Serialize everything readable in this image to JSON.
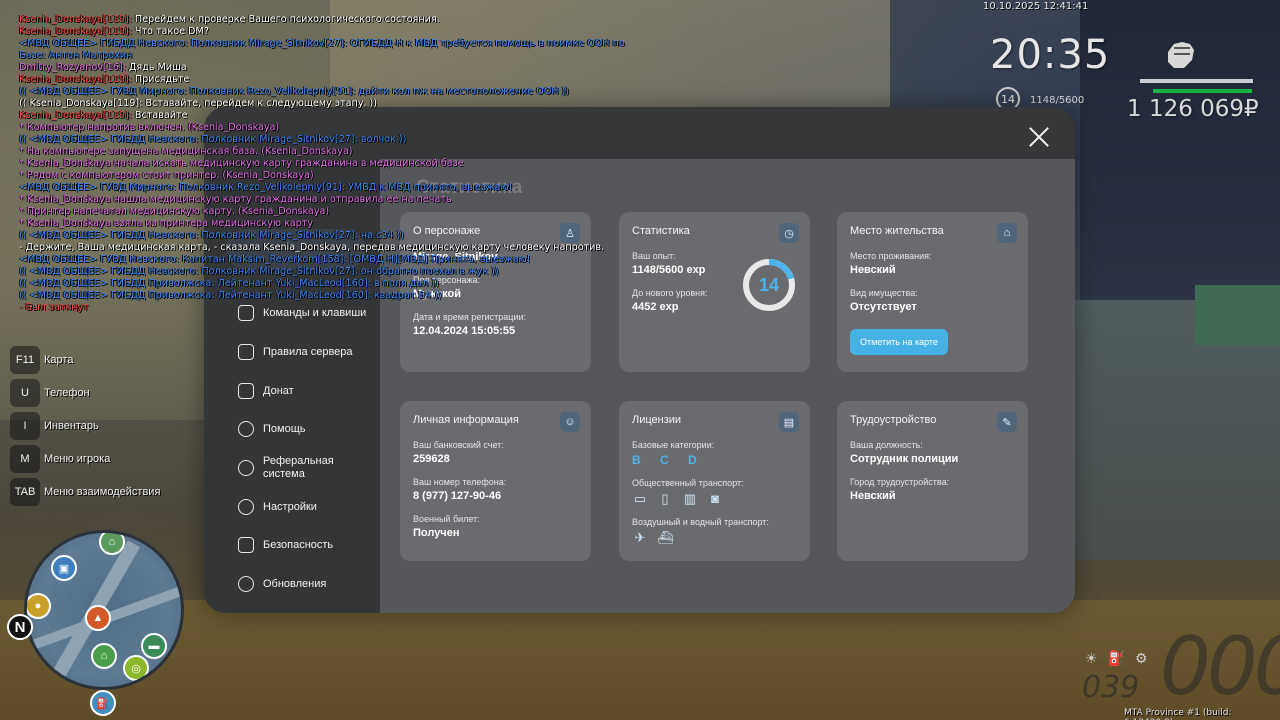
{
  "chat": [
    {
      "color": "red",
      "name": "Ksenia_Donskaya[119]:",
      "text": " Перейдем к проверке Вашего психологического состояния."
    },
    {
      "color": "red",
      "name": "Ksenia_Donskaya[119]:",
      "text": " Что такое DM?"
    },
    {
      "color": "blue",
      "name": "",
      "text": "<МВД ОБЩЕЕ> ГИБДД Невского: Полковник Mirage_Sitnikov[27]: ОГИБДД-Н к МВД требуется помощь в поимке ООН по"
    },
    {
      "color": "blue",
      "name": "",
      "text": " Базе: Антон Матрохин"
    },
    {
      "color": "pink",
      "name": "Dmitry_Rozyanov[16]:",
      "text": " Дядь Миша"
    },
    {
      "color": "red",
      "name": "Ksenia_Donskaya[119]:",
      "text": " Присядьте"
    },
    {
      "color": "blue",
      "name": "",
      "text": "(( <МВД ОБЩЕЕ> ГУВД Мирного: Полковник Rezo_Velikolepniy[91]: дайти кол пж на местоположение ООН ))"
    },
    {
      "color": "white",
      "name": "",
      "text": "(( Ksenia_Donskaya[119]: Вставайте, перейдем к следующему этапу. ))"
    },
    {
      "color": "red",
      "name": "Ksenia_Donskaya[119]:",
      "text": " Вставайте"
    },
    {
      "color": "pink",
      "name": "",
      "text": "* Компьютер напротив включен. (Ksenia_Donskaya)"
    },
    {
      "color": "blue",
      "name": "",
      "text": "(( <МВД ОБЩЕЕ> ГИБДД Невского: Полковник Mirage_Sitnikov[27]: волчок ))"
    },
    {
      "color": "pink",
      "name": "",
      "text": "* На компьютере запущена медицинская база. (Ksenia_Donskaya)"
    },
    {
      "color": "pink",
      "name": "",
      "text": "* Ksenia_Donskaya начала искать медицинскую карту гражданина в медицинской базе"
    },
    {
      "color": "pink",
      "name": "",
      "text": "* Рядом с компьютером стоит принтер. (Ksenia_Donskaya)"
    },
    {
      "color": "blue",
      "name": "",
      "text": "<МВД ОБЩЕЕ> ГУВД Мирного: Полковник Rezo_Velikolepniy[91]: УМВД к МВД принято, выезжаю!"
    },
    {
      "color": "pink",
      "name": "",
      "text": "* Ksenia_Donskaya нашла медицинскую карту гражданина и отправила ее на печать"
    },
    {
      "color": "pink",
      "name": "",
      "text": "* Принтер напечатал медицинскую карту. (Ksenia_Donskaya)"
    },
    {
      "color": "pink",
      "name": "",
      "text": "* Ksenia_Donskaya взяла из принтера медицинскую карту"
    },
    {
      "color": "blue",
      "name": "",
      "text": "(( <МВД ОБЩЕЕ> ГИБДД Невского: Полковник Mirage_Sitnikov[27]: на с34 ))"
    },
    {
      "color": "white",
      "name": "",
      "text": "- Держите, Ваша медицинская карта, - сказала Ksenia_Donskaya, передав медицинскую карту человеку напротив."
    },
    {
      "color": "blue",
      "name": "",
      "text": "<МВД ОБЩЕЕ> ГУВД Невского: Капитан Maksim_Reverkom[158]: [ОМВД-Н][МВД] Принято, выезжаю!"
    },
    {
      "color": "blue",
      "name": "",
      "text": "(( <МВД ОБЩЕЕ> ГИБДД Невского: Полковник Mirage_Sitnikov[27]: он обратно поехал в жук ))"
    },
    {
      "color": "blue",
      "name": "",
      "text": "(( <МВД ОБЩЕЕ> ГИБДД Приволжска: Лейтенант Yuki_MacLeod[160]: в поля дал ))"
    },
    {
      "color": "blue",
      "name": "",
      "text": "(( <МВД ОБЩЕЕ> ГИБДД Приволжска: Лейтенант Yuki_MacLeod[160]: квадрат В4 ))"
    },
    {
      "color": "red",
      "name": "",
      "text": "- Был заткнут"
    }
  ],
  "hud": {
    "datetime": "10.10.2025 12:41:41",
    "time": "20:35",
    "level": "14",
    "exp": "1148/5600",
    "money": "1 126 069₽",
    "health_pct": 100,
    "armor_pct": 88,
    "build": "MTA Province #1 (build: 6.12420.9)",
    "speed": "000",
    "fuel": "039"
  },
  "hotkeys": [
    {
      "key": "F11",
      "label": "Карта"
    },
    {
      "key": "U",
      "label": "Телефон"
    },
    {
      "key": "I",
      "label": "Инвентарь"
    },
    {
      "key": "M",
      "label": "Меню игрока"
    },
    {
      "key": "TAB",
      "label": "Меню взаимодействия"
    }
  ],
  "minimap": {
    "north": "N"
  },
  "modal": {
    "title": "Статистика",
    "nav": [
      {
        "label": "Команды и клавиши",
        "icon": "document-icon"
      },
      {
        "label": "Правила сервера",
        "icon": "scales-icon"
      },
      {
        "label": "Донат",
        "icon": "wallet-icon"
      },
      {
        "label": "Помощь",
        "icon": "heart-hands-icon"
      },
      {
        "label": "Реферальная система",
        "icon": "network-icon"
      },
      {
        "label": "Настройки",
        "icon": "gear-icon"
      },
      {
        "label": "Безопасность",
        "icon": "shield-icon"
      },
      {
        "label": "Обновления",
        "icon": "refresh-icon"
      }
    ],
    "character": {
      "title": "О персонаже",
      "name": "Mirage_Sitnikov",
      "gender_label": "Пол персонажа:",
      "gender_value": "Мужской",
      "reg_label": "Дата и время регистрации:",
      "reg_value": "12.04.2024 15:05:55"
    },
    "stats": {
      "title": "Статистика",
      "exp_label": "Ваш опыт:",
      "exp_value": "1148/5600 exp",
      "next_label": "До нового уровня:",
      "next_value": "4452 exp",
      "level": "14",
      "progress": 0.205
    },
    "residence": {
      "title": "Место жительства",
      "live_label": "Место проживания:",
      "live_value": "Невский",
      "property_label": "Вид имущества:",
      "property_value": "Отсутствует",
      "map_button": "Отметить на карте"
    },
    "personal": {
      "title": "Личная информация",
      "bank_label": "Ваш банковский счет:",
      "bank_value": "259628",
      "phone_label": "Ваш номер телефона:",
      "phone_value": "8 (977) 127-90-46",
      "military_label": "Военный билет:",
      "military_value": "Получен"
    },
    "licenses": {
      "title": "Лицензии",
      "base_label": "Базовые категории:",
      "base_value": "B C D",
      "public_label": "Общественный транспорт:",
      "air_label": "Воздушный и водный транспорт:"
    },
    "employment": {
      "title": "Трудоустройство",
      "position_label": "Ваша должность:",
      "position_value": "Сотрудник полиции",
      "city_label": "Город трудоустройства:",
      "city_value": "Невский"
    }
  },
  "colors": {
    "accent": "#45b1e5",
    "armor": "#18b23e",
    "chat_red": "#ff4040",
    "chat_blue": "#3a86ff",
    "chat_pink": "#e36ee8"
  }
}
